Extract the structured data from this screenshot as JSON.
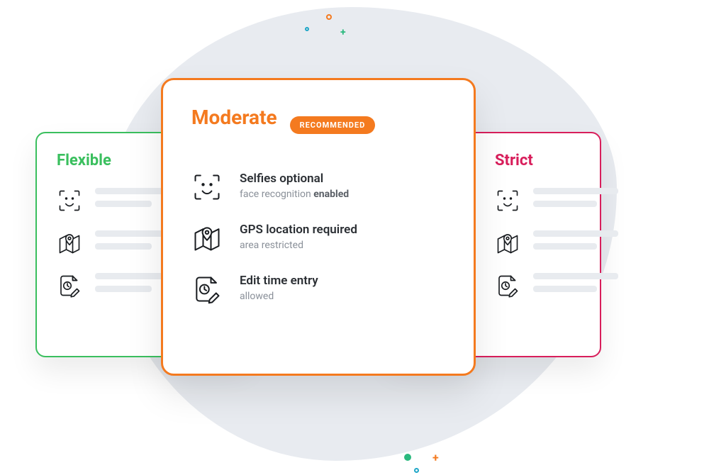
{
  "cards": {
    "flexible": {
      "title": "Flexible"
    },
    "moderate": {
      "title": "Moderate",
      "badge": "RECOMMENDED",
      "items": [
        {
          "title": "Selfies optional",
          "sub_prefix": "face recognition ",
          "sub_strong": "enabled"
        },
        {
          "title": "GPS location required",
          "sub_prefix": "area restricted",
          "sub_strong": ""
        },
        {
          "title": "Edit time entry",
          "sub_prefix": "allowed",
          "sub_strong": ""
        }
      ]
    },
    "strict": {
      "title": "Strict"
    }
  }
}
